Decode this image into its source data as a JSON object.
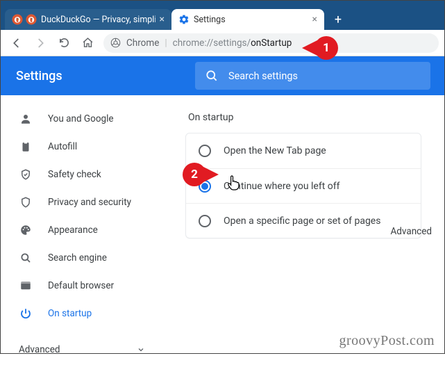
{
  "browser": {
    "tabs": [
      {
        "title": "DuckDuckGo — Privacy, simplifie"
      },
      {
        "title": "Settings"
      }
    ],
    "omnibox": {
      "scheme_label": "Chrome",
      "url_gray": "chrome://settings/",
      "url_path": "onStartup"
    }
  },
  "header": {
    "title": "Settings",
    "search_placeholder": "Search settings"
  },
  "sidebar": {
    "items": [
      {
        "label": "You and Google"
      },
      {
        "label": "Autofill"
      },
      {
        "label": "Safety check"
      },
      {
        "label": "Privacy and security"
      },
      {
        "label": "Appearance"
      },
      {
        "label": "Search engine"
      },
      {
        "label": "Default browser"
      },
      {
        "label": "On startup"
      }
    ],
    "advanced_label": "Advanced"
  },
  "main": {
    "section_title": "On startup",
    "options": [
      {
        "label": "Open the New Tab page"
      },
      {
        "label": "Continue where you left off"
      },
      {
        "label": "Open a specific page or set of pages"
      }
    ],
    "advanced_link": "Advanced"
  },
  "callouts": {
    "c1": "1",
    "c2": "2"
  },
  "watermark": "groovyPost.com"
}
